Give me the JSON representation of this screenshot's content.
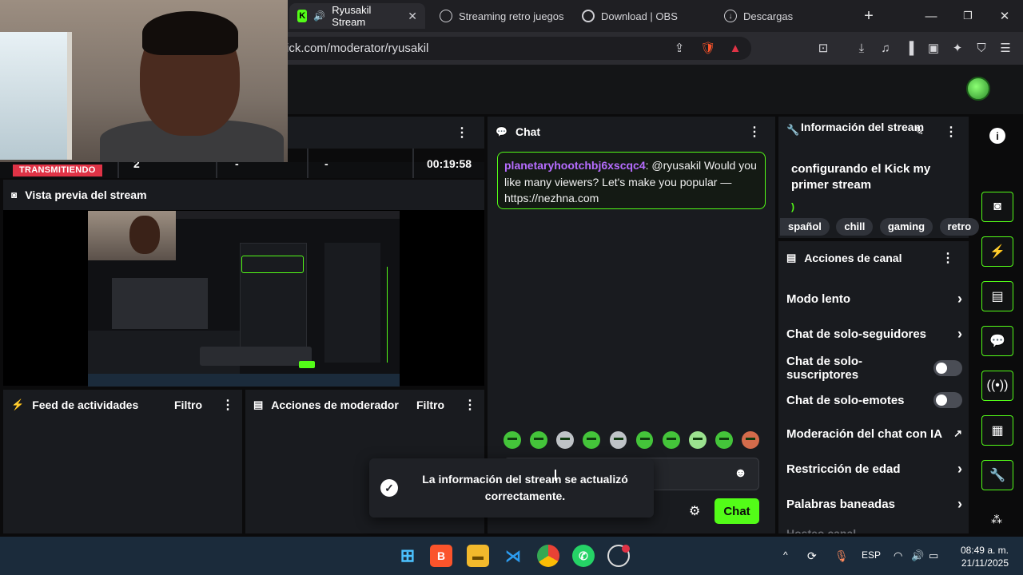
{
  "browser": {
    "tabs": [
      {
        "label": "Ryusakil Stream",
        "active": true,
        "fav": "K"
      },
      {
        "label": "Streaming retro juegos",
        "active": false,
        "fav": "gpt-icon"
      },
      {
        "label": "Download | OBS",
        "active": false,
        "fav": "obs-icon"
      },
      {
        "label": "Descargas",
        "active": false,
        "fav": "download-icon"
      }
    ],
    "url": "ick.com/moderator/ryusakil",
    "accent": "#53fc18"
  },
  "stream": {
    "status": "TRANSMITIENDO",
    "viewers": "2",
    "stat2": "-",
    "stat3": "-",
    "uptime": "00:19:58",
    "preview_title": "Vista previa del stream"
  },
  "activity": {
    "title": "Feed de actividades",
    "filter": "Filtro"
  },
  "modactions": {
    "title": "Acciones de moderador",
    "filter": "Filtro"
  },
  "chat": {
    "title": "Chat",
    "message": {
      "user": "planetaryhootchbj6xscqc4",
      "text": ": @ryusakil Would you like many viewers? Let's make you popular — https://nezhna.com"
    },
    "button": "Chat"
  },
  "toast": {
    "message": "La información del stream se actualizó correctamente."
  },
  "info": {
    "title": "Información del stream",
    "stream_title": "configurando el Kick my primer stream",
    "category_fragment": ")",
    "tags": [
      "spañol",
      "chill",
      "gaming",
      "retro"
    ]
  },
  "actions": {
    "title": "Acciones de canal",
    "items": [
      {
        "label": "Modo lento",
        "control": "chevron"
      },
      {
        "label": "Chat de solo-seguidores",
        "control": "chevron"
      },
      {
        "label": "Chat de solo-suscriptores",
        "control": "toggle"
      },
      {
        "label": "Chat de solo-emotes",
        "control": "toggle"
      },
      {
        "label": "Moderación del chat con IA",
        "control": "external"
      },
      {
        "label": "Restricción de edad",
        "control": "chevron"
      },
      {
        "label": "Palabras baneadas",
        "control": "chevron"
      }
    ],
    "cut_label": "Hosteo canal"
  },
  "taskbar": {
    "lang": "ESP",
    "time": "08:49 a. m.",
    "date": "21/11/2025"
  }
}
